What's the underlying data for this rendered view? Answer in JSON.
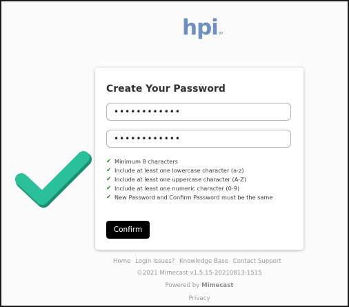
{
  "logo": {
    "text": "hpi",
    "tm": "TM"
  },
  "form": {
    "title": "Create Your Password",
    "password_value": "••••••••••••",
    "confirm_password_value": "••••••••••••",
    "requirements": [
      "Minimum 8 characters",
      "Include at least one lowercase character (a-z)",
      "Include at least one uppercase character (A-Z)",
      "Include at least one numeric character (0-9)",
      "New Password and Confirm Password must be the same"
    ],
    "requirement_check_glyph": "✔",
    "confirm_label": "Confirm"
  },
  "footer": {
    "links": [
      "Home",
      "Login Issues?",
      "Knowledge Base",
      "Contact Support"
    ],
    "version": "©2021 Mimecast v1.5.15-20210813-1515",
    "powered_prefix": "Powered by",
    "powered_brand": "Mimecast",
    "privacy": "Privacy"
  },
  "colors": {
    "logo": "#6f8fc0",
    "checkmark": "#2bbf9a",
    "requirement_check": "#2a8a2a",
    "button": "#000000"
  },
  "icons": {
    "big_check": "large-teal-checkmark-icon",
    "req_check": "check-icon"
  }
}
